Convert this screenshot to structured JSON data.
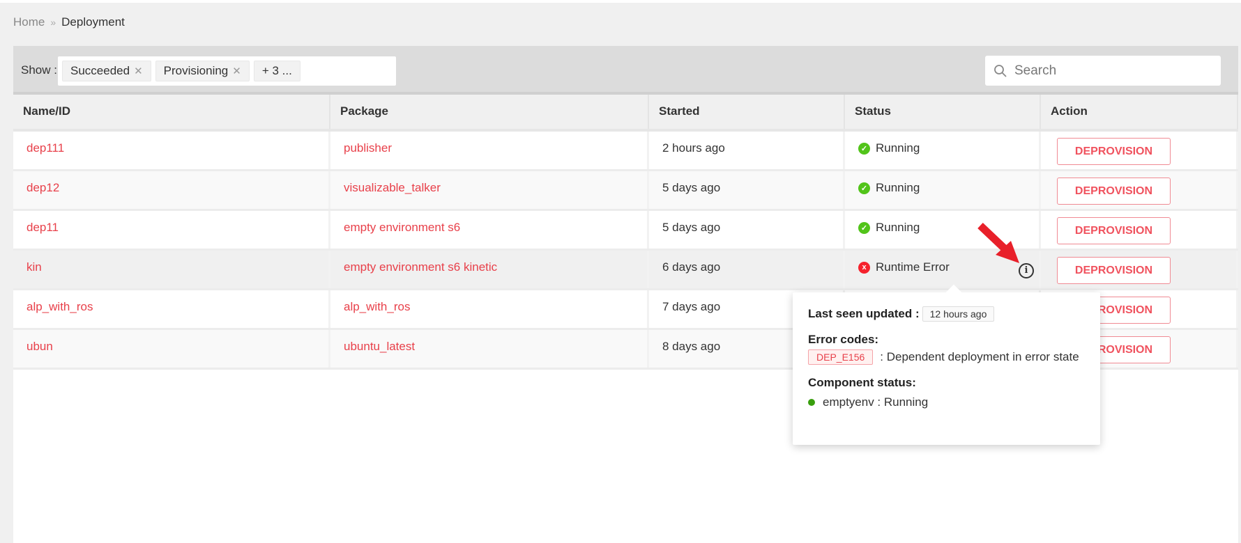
{
  "breadcrumb": {
    "home": "Home",
    "separator": "»",
    "current": "Deployment"
  },
  "filter": {
    "label": "Show :",
    "tags": [
      "Succeeded",
      "Provisioning"
    ],
    "more": "+ 3 ..."
  },
  "search": {
    "placeholder": "Search"
  },
  "table": {
    "headers": [
      "Name/ID",
      "Package",
      "Started",
      "Status",
      "Action"
    ],
    "rows": [
      {
        "name": "dep111",
        "package": "publisher",
        "started": "2 hours ago",
        "status": "Running",
        "action": "DEPROVISION"
      },
      {
        "name": "dep12",
        "package": "visualizable_talker",
        "started": "5 days ago",
        "status": "Running",
        "action": "DEPROVISION"
      },
      {
        "name": "dep11",
        "package": "empty environment s6",
        "started": "5 days ago",
        "status": "Running",
        "action": "DEPROVISION"
      },
      {
        "name": "kin",
        "package": "empty environment s6 kinetic",
        "started": "6 days ago",
        "status": "Runtime Error",
        "action": "DEPROVISION"
      },
      {
        "name": "alp_with_ros",
        "package": "alp_with_ros",
        "started": "7 days ago",
        "status": "",
        "action": "DEPROVISION"
      },
      {
        "name": "ubun",
        "package": "ubuntu_latest",
        "started": "8 days ago",
        "status": "",
        "action": "DEPROVISION"
      }
    ]
  },
  "popover": {
    "last_seen_label": "Last seen updated :",
    "last_seen_value": "12 hours ago",
    "error_codes_label": "Error codes:",
    "error_code": "DEP_E156",
    "error_desc": ": Dependent deployment in error state",
    "component_label": "Component status:",
    "component": "emptyenv : Running"
  },
  "colors": {
    "accent": "#e8404a",
    "running": "#52c41a",
    "error": "#f5222d"
  }
}
